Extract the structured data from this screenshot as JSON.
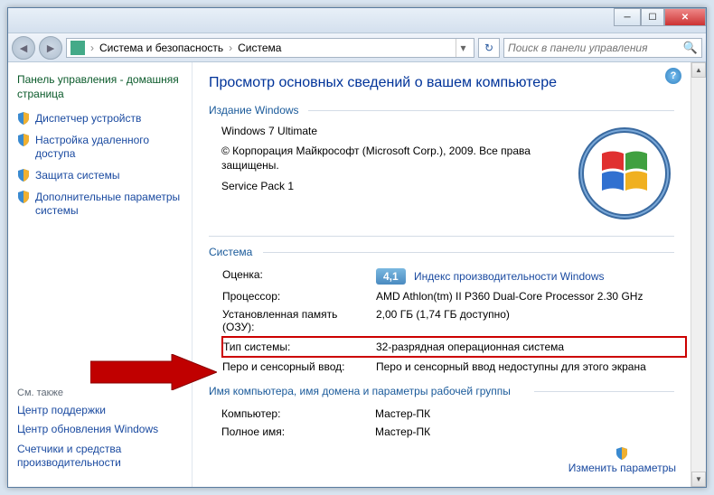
{
  "breadcrumb": {
    "part1": "Система и безопасность",
    "part2": "Система"
  },
  "search": {
    "placeholder": "Поиск в панели управления"
  },
  "sidebar": {
    "home": "Панель управления - домашняя страница",
    "links": [
      "Диспетчер устройств",
      "Настройка удаленного доступа",
      "Защита системы",
      "Дополнительные параметры системы"
    ],
    "see_also_label": "См. также",
    "see_also": [
      "Центр поддержки",
      "Центр обновления Windows",
      "Счетчики и средства производительности"
    ]
  },
  "content": {
    "title": "Просмотр основных сведений о вашем компьютере",
    "edition_group": "Издание Windows",
    "edition": "Windows 7 Ultimate",
    "copyright": "© Корпорация Майкрософт (Microsoft Corp.), 2009. Все права защищены.",
    "service_pack": "Service Pack 1",
    "system_group": "Система",
    "computer_group": "Имя компьютера, имя домена и параметры рабочей группы",
    "change_settings": "Изменить параметры",
    "rows": {
      "rating_label": "Оценка:",
      "rating_value": "4,1",
      "rating_link": "Индекс производительности Windows",
      "cpu_label": "Процессор:",
      "cpu_value": "AMD Athlon(tm) II P360 Dual-Core Processor   2.30 GHz",
      "ram_label": "Установленная память (ОЗУ):",
      "ram_value": "2,00 ГБ (1,74 ГБ доступно)",
      "systype_label": "Тип системы:",
      "systype_value": "32-разрядная операционная система",
      "pen_label": "Перо и сенсорный ввод:",
      "pen_value": "Перо и сенсорный ввод недоступны для этого экрана",
      "computer_label": "Компьютер:",
      "computer_value": "Мастер-ПК",
      "fullname_label": "Полное имя:",
      "fullname_value": "Мастер-ПК"
    }
  }
}
